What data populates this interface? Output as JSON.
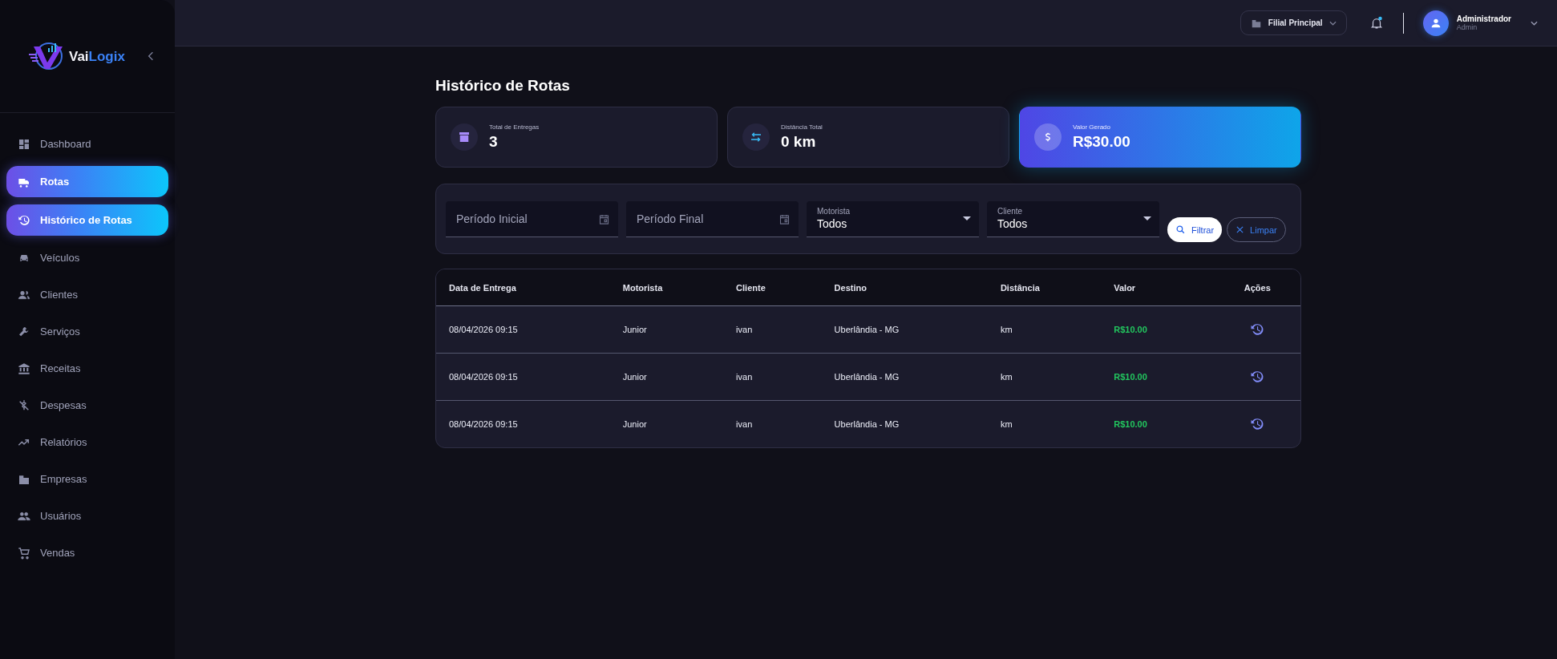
{
  "sidebar": {
    "logo": {
      "name_part_1": "Vai",
      "name_part_2": "Logix"
    },
    "items": [
      {
        "label": "Dashboard",
        "selected": false
      },
      {
        "label": "Rotas",
        "selected": true
      },
      {
        "label": "Histórico de Rotas",
        "selected": true
      },
      {
        "label": "Veículos",
        "selected": false
      },
      {
        "label": "Clientes",
        "selected": false
      },
      {
        "label": "Serviços",
        "selected": false
      },
      {
        "label": "Receitas",
        "selected": false
      },
      {
        "label": "Despesas",
        "selected": false
      },
      {
        "label": "Relatórios",
        "selected": false
      },
      {
        "label": "Empresas",
        "selected": false
      },
      {
        "label": "Usuários",
        "selected": false
      },
      {
        "label": "Vendas",
        "selected": false
      }
    ]
  },
  "topbar": {
    "branch": "Filial Principal",
    "notification_dot": true,
    "user": {
      "name": "Administrador",
      "role": "Admin"
    }
  },
  "page": {
    "title": "Histórico de Rotas"
  },
  "stats": [
    {
      "label": "Total de Entregas",
      "value": "3",
      "highlighted": false
    },
    {
      "label": "Distância Total",
      "value": "0 km",
      "highlighted": false
    },
    {
      "label": "Valor Gerado",
      "value": "R$30.00",
      "highlighted": true
    }
  ],
  "filters": {
    "fields": [
      {
        "kind": "date",
        "placeholder": "Período Inicial"
      },
      {
        "kind": "date",
        "placeholder": "Período Final"
      },
      {
        "kind": "select",
        "label": "Motorista",
        "value": "Todos"
      },
      {
        "kind": "select",
        "label": "Cliente",
        "value": "Todos"
      }
    ],
    "buttons": [
      {
        "kind": "primary",
        "label": "Filtrar"
      },
      {
        "kind": "outline",
        "label": "Limpar"
      }
    ]
  },
  "table": {
    "columns": [
      "Data de Entrega",
      "Motorista",
      "Cliente",
      "Destino",
      "Distância",
      "Valor",
      "Ações"
    ],
    "rows": [
      [
        "08/04/2026 09:15",
        "Junior",
        "ivan",
        "Uberlândia - MG",
        "km",
        "R$10.00"
      ],
      [
        "08/04/2026 09:15",
        "Junior",
        "ivan",
        "Uberlândia - MG",
        "km",
        "R$10.00"
      ],
      [
        "08/04/2026 09:15",
        "Junior",
        "ivan",
        "Uberlândia - MG",
        "km",
        "R$10.00"
      ]
    ]
  }
}
